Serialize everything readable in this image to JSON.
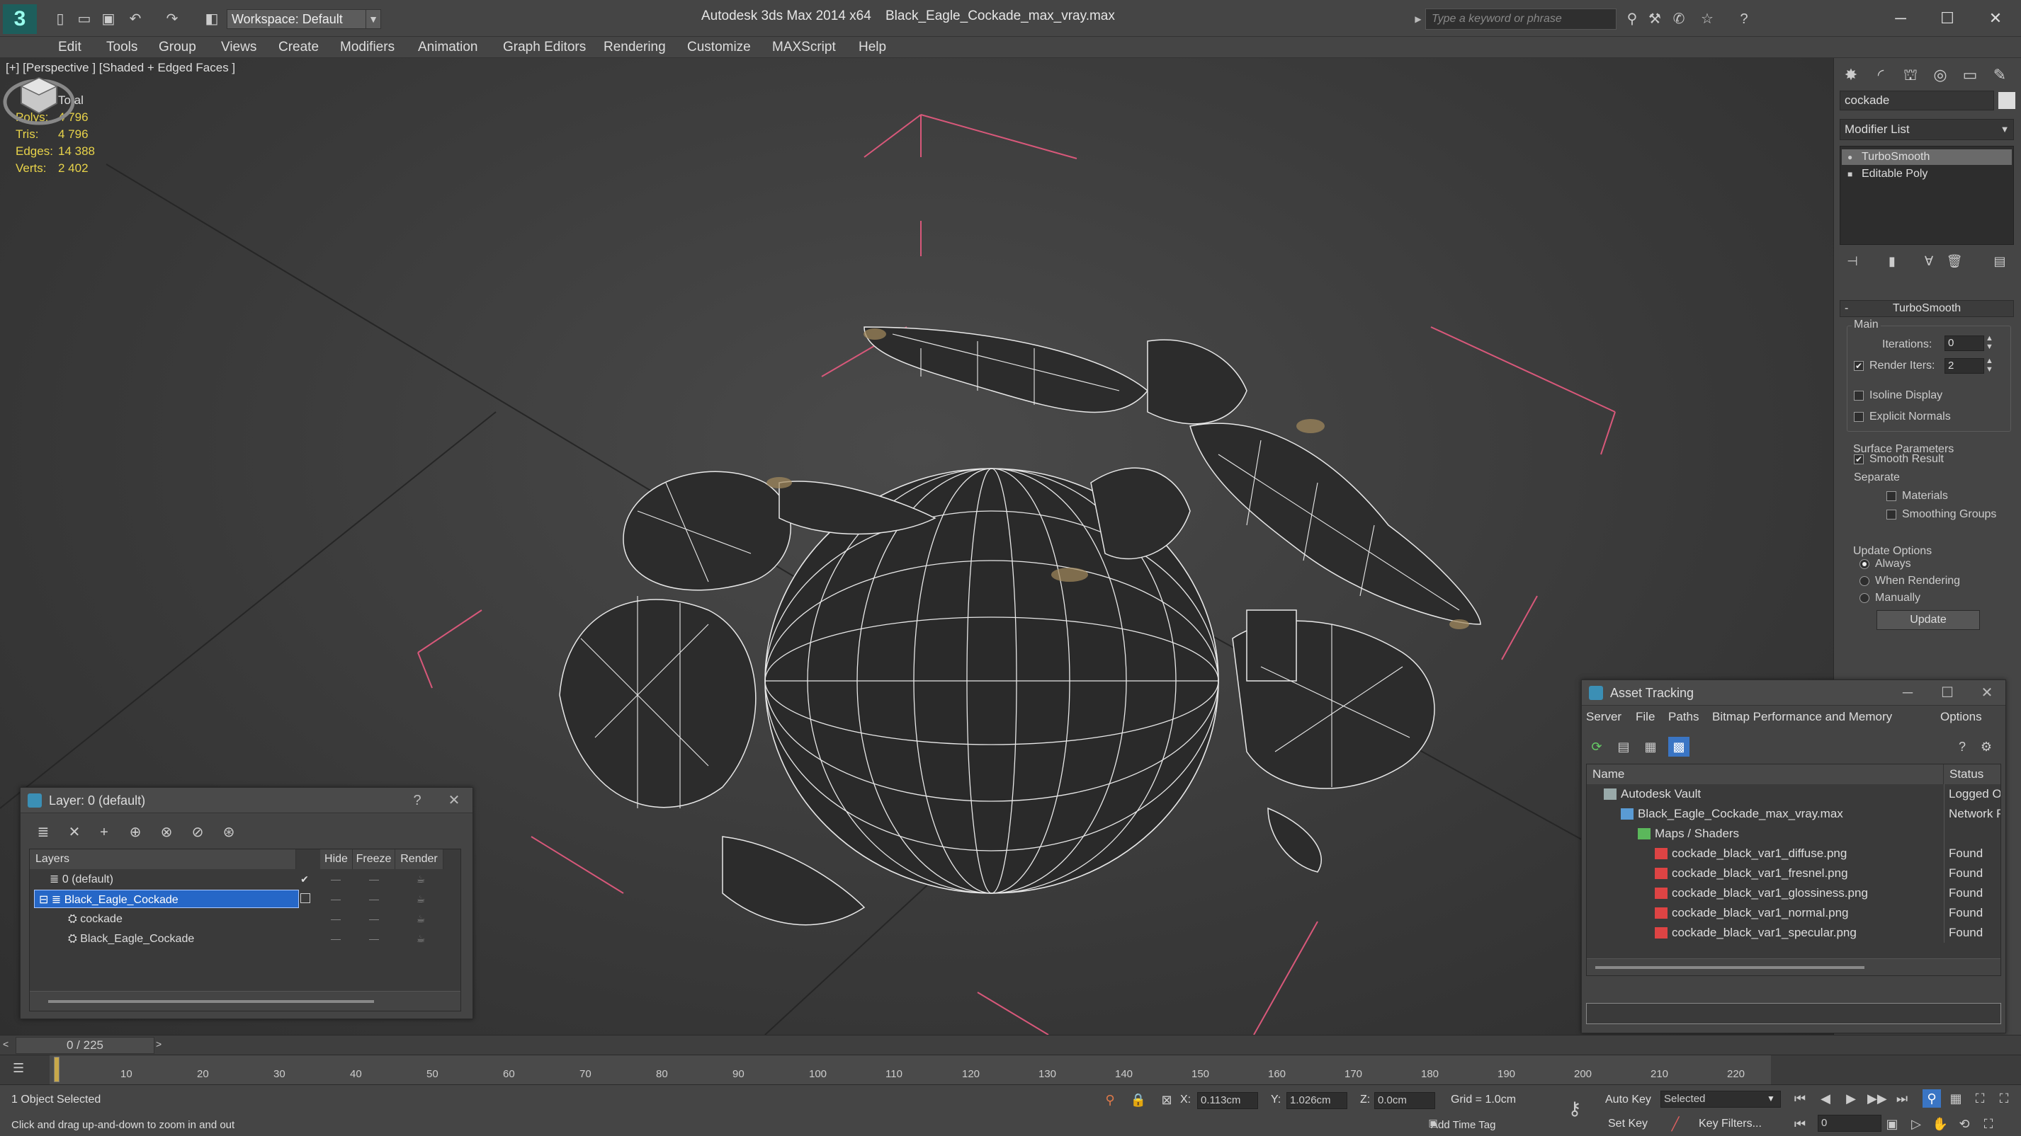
{
  "titlebar": {
    "workspace": "Workspace: Default",
    "app_title": "Autodesk 3ds Max  2014 x64",
    "file_title": "Black_Eagle_Cockade_max_vray.max",
    "search_placeholder": "Type a keyword or phrase"
  },
  "menu": [
    "Edit",
    "Tools",
    "Group",
    "Views",
    "Create",
    "Modifiers",
    "Animation",
    "Graph Editors",
    "Rendering",
    "Customize",
    "MAXScript",
    "Help"
  ],
  "viewport": {
    "label": "[+] [Perspective ] [Shaded + Edged Faces ]",
    "stats": {
      "total_label": "Total",
      "rows": [
        {
          "k": "Polys:",
          "v": "4 796"
        },
        {
          "k": "Tris:",
          "v": "4 796"
        },
        {
          "k": "Edges:",
          "v": "14 388"
        },
        {
          "k": "Verts:",
          "v": "2 402"
        }
      ]
    }
  },
  "command_panel": {
    "object_name": "cockade",
    "modifier_list": "Modifier List",
    "stack": [
      "TurboSmooth",
      "Editable Poly"
    ],
    "rollout": "TurboSmooth",
    "main_label": "Main",
    "iterations_label": "Iterations:",
    "iterations_value": "0",
    "render_iters_label": "Render Iters:",
    "render_iters_value": "2",
    "isoline": "Isoline Display",
    "explicit_normals": "Explicit Normals",
    "surface_params": "Surface Parameters",
    "smooth_result": "Smooth Result",
    "separate": "Separate",
    "materials": "Materials",
    "smoothing_groups": "Smoothing Groups",
    "update_options": "Update Options",
    "always": "Always",
    "when_rendering": "When Rendering",
    "manually": "Manually",
    "update_button": "Update"
  },
  "layer_panel": {
    "title": "Layer: 0 (default)",
    "help": "?",
    "columns": [
      "Layers",
      "Hide",
      "Freeze",
      "Render"
    ],
    "rows": [
      {
        "name": "0 (default)",
        "indent": 0,
        "check": "✔"
      },
      {
        "name": "Black_Eagle_Cockade",
        "indent": 0,
        "check": ""
      },
      {
        "name": "cockade",
        "indent": 1,
        "check": ""
      },
      {
        "name": "Black_Eagle_Cockade",
        "indent": 1,
        "check": ""
      }
    ]
  },
  "asset_panel": {
    "title": "Asset Tracking",
    "menu": [
      "Server",
      "File",
      "Paths",
      "Bitmap Performance and Memory",
      "Options"
    ],
    "columns": [
      "Name",
      "Status"
    ],
    "rows": [
      {
        "name": "Autodesk Vault",
        "status": "Logged O",
        "indent": 1,
        "icon": "vault"
      },
      {
        "name": "Black_Eagle_Cockade_max_vray.max",
        "status": "Network P",
        "indent": 2,
        "icon": "max"
      },
      {
        "name": "Maps / Shaders",
        "status": "",
        "indent": 3,
        "icon": "maps"
      },
      {
        "name": "cockade_black_var1_diffuse.png",
        "status": "Found",
        "indent": 4,
        "icon": "png"
      },
      {
        "name": "cockade_black_var1_fresnel.png",
        "status": "Found",
        "indent": 4,
        "icon": "png"
      },
      {
        "name": "cockade_black_var1_glossiness.png",
        "status": "Found",
        "indent": 4,
        "icon": "png"
      },
      {
        "name": "cockade_black_var1_normal.png",
        "status": "Found",
        "indent": 4,
        "icon": "png"
      },
      {
        "name": "cockade_black_var1_specular.png",
        "status": "Found",
        "indent": 4,
        "icon": "png"
      }
    ]
  },
  "timeline": {
    "frame": "0 / 225",
    "ticks": [
      "10",
      "20",
      "30",
      "40",
      "50",
      "60",
      "70",
      "80",
      "90",
      "100",
      "110",
      "120",
      "130",
      "140",
      "150",
      "160",
      "170",
      "180",
      "190",
      "200",
      "210",
      "220"
    ]
  },
  "status": {
    "selected": "1 Object Selected",
    "prompt": "Click and drag up-and-down to zoom in and out",
    "x_label": "X:",
    "x_value": "0.113cm",
    "y_label": "Y:",
    "y_value": "1.026cm",
    "z_label": "Z:",
    "z_value": "0.0cm",
    "grid": "Grid = 1.0cm",
    "auto_key": "Auto Key",
    "set_key": "Set Key",
    "selected_dropdown": "Selected",
    "key_filters": "Key Filters...",
    "add_time_tag": "Add Time Tag",
    "frame_field": "0"
  },
  "colors": {
    "accent_blue": "#2667c7",
    "stats_yellow": "#e8d34a",
    "bbox_pink": "#d8587a"
  }
}
